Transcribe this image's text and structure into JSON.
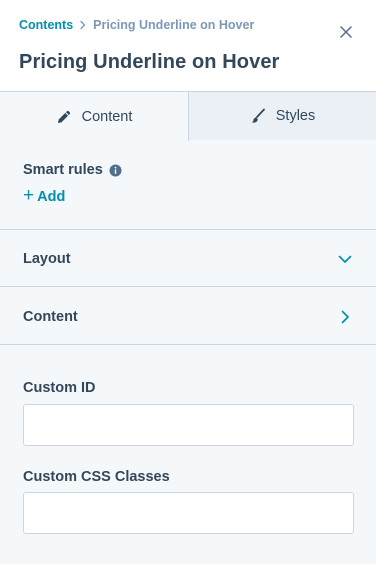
{
  "header": {
    "breadcrumb": {
      "link": "Contents",
      "separator_icon": "chevron-right-icon",
      "current": "Pricing Underline on Hover"
    },
    "title": "Pricing Underline on Hover",
    "close_icon": "close-icon"
  },
  "tabs": [
    {
      "label": "Content",
      "icon": "pencil-icon",
      "selected": true
    },
    {
      "label": "Styles",
      "icon": "brush-icon",
      "selected": false
    }
  ],
  "smart_rules": {
    "label": "Smart rules",
    "info_icon": "info-icon",
    "add_label": "Add"
  },
  "sections": [
    {
      "label": "Layout",
      "icon": "chevron-down-icon"
    },
    {
      "label": "Content",
      "icon": "chevron-right-icon"
    }
  ],
  "fields": {
    "custom_id": {
      "label": "Custom ID",
      "value": ""
    },
    "custom_css": {
      "label": "Custom CSS Classes",
      "value": ""
    }
  },
  "colors": {
    "accent": "#0091ae",
    "text": "#33475b",
    "muted": "#7c98b6",
    "border": "#cbd6e2",
    "panel_bg": "#f5f8fa",
    "tab_inactive_bg": "#eaf0f6"
  }
}
